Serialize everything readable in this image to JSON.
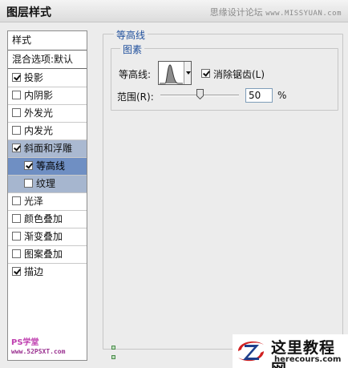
{
  "window": {
    "title": "图层样式",
    "watermark_cn": "思缘设计论坛",
    "watermark_url": "www.MISSYUAN.com"
  },
  "style_list": {
    "header": "样式",
    "blend_options": "混合选项:默认",
    "items": [
      {
        "label": "投影",
        "checked": true
      },
      {
        "label": "内阴影",
        "checked": false
      },
      {
        "label": "外发光",
        "checked": false
      },
      {
        "label": "内发光",
        "checked": false
      },
      {
        "label": "斜面和浮雕",
        "checked": true
      },
      {
        "label": "等高线",
        "checked": true
      },
      {
        "label": "纹理",
        "checked": false
      },
      {
        "label": "光泽",
        "checked": false
      },
      {
        "label": "颜色叠加",
        "checked": false
      },
      {
        "label": "渐变叠加",
        "checked": false
      },
      {
        "label": "图案叠加",
        "checked": false
      },
      {
        "label": "描边",
        "checked": true
      }
    ],
    "footer_brand": "PS学堂",
    "footer_url": "www.52PSXT.com"
  },
  "contour_panel": {
    "group_title": "等高线",
    "subgroup_title": "图素",
    "contour_label": "等高线:",
    "antialias_label": "消除锯齿(L)",
    "antialias_checked": true,
    "range_label": "范围(R):",
    "range_value": "50",
    "range_unit": "%",
    "range_fraction": 0.5
  },
  "logo": {
    "cn": "这里教程网",
    "en": "herecours.com"
  },
  "colors": {
    "legend": "#1f4f9c",
    "highlight": "#aab9d1",
    "selected": "#6f8fc3",
    "logo_red": "#d02020",
    "logo_blue": "#1f3f8c"
  }
}
